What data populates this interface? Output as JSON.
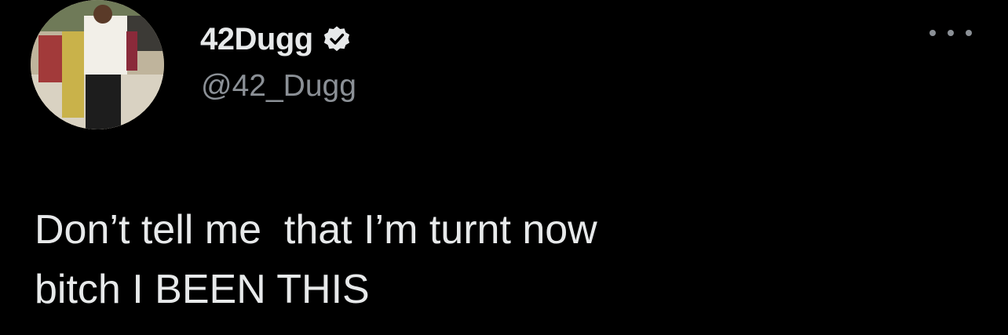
{
  "tweet": {
    "author": {
      "display_name": "42Dugg",
      "handle": "@42_Dugg",
      "verified": true,
      "verified_icon": "verified-badge-icon",
      "avatar_icon": "profile-photo"
    },
    "menu_icon": "more-options-icon",
    "text": "Don’t tell me  that I’m turnt now\nbitch I BEEN THIS"
  },
  "colors": {
    "background": "#000000",
    "primary_text": "#e7e9ea",
    "secondary_text": "#8b9096"
  }
}
